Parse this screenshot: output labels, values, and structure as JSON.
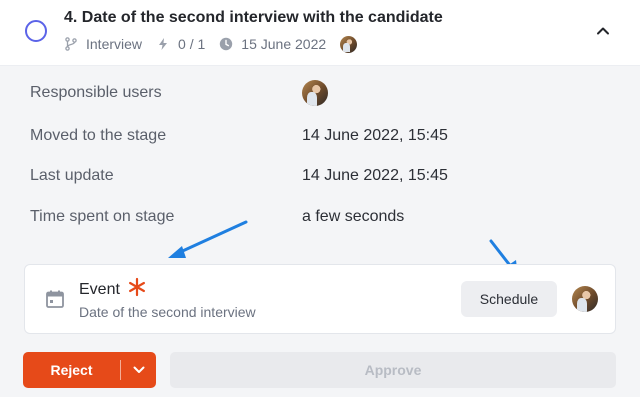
{
  "header": {
    "title": "4. Date of the second interview with the candidate",
    "meta": {
      "stage_type": "Interview",
      "progress": "0 / 1",
      "date": "15 June 2022"
    }
  },
  "details": [
    {
      "label": "Responsible users",
      "value": ""
    },
    {
      "label": "Moved to the stage",
      "value": "14 June 2022, 15:45"
    },
    {
      "label": "Last update",
      "value": "14 June 2022, 15:45"
    },
    {
      "label": "Time spent on stage",
      "value": "a few seconds"
    }
  ],
  "event": {
    "title": "Event",
    "subtitle": "Date of the second interview",
    "schedule_label": "Schedule",
    "required": true
  },
  "actions": {
    "reject_label": "Reject",
    "approve_label": "Approve"
  },
  "colors": {
    "accent": "#5b63e8",
    "reject": "#e64a19",
    "required_star": "#e64a19",
    "annotation_arrow": "#1f7fe0"
  },
  "icons": {
    "status": "circle-outline-icon",
    "stage_type": "branch-icon",
    "progress": "lightning-icon",
    "date": "clock-icon",
    "collapse": "chevron-up-icon",
    "event": "calendar-icon",
    "required": "asterisk-icon",
    "reject_menu": "chevron-down-icon"
  }
}
